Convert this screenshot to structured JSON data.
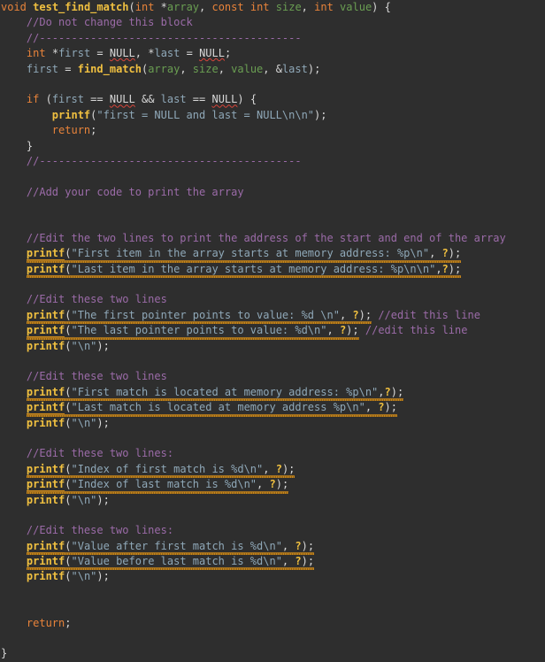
{
  "editor": {
    "language": "c",
    "background_color": "#2e2e2e",
    "colors": {
      "keyword": "#e8833a",
      "function": "#f0c040",
      "parameter": "#6a9e52",
      "variable": "#8fa8b8",
      "string": "#8fa8b8",
      "punctuation": "#d8d8d8",
      "comment": "#9b6ba8",
      "spell_error_underline": "#d9453a",
      "syntax_error_underline": "#c8881e"
    }
  },
  "code": {
    "signature": {
      "return_type": "void",
      "name": "test_find_match",
      "p1_type": "int",
      "p1_star": "*",
      "p1_name": "array",
      "p2_const": "const",
      "p2_type": "int",
      "p2_name": "size",
      "p3_type": "int",
      "p3_name": "value",
      "open_paren": "(",
      "close_paren": ")",
      "comma": ", ",
      "open_brace": " {"
    },
    "comments": {
      "do_not_change": "//Do not change this block",
      "separator": "//-----------------------------------------",
      "add_your_code": "//Add your code to print the array",
      "edit_two_lines_address": "//Edit the two lines to print the address of the start and end of the array",
      "edit_these_two_lines": "//Edit these two lines",
      "edit_these_two_lines_colon": "//Edit these two lines:",
      "edit_this_line": "//edit this line"
    },
    "decl": {
      "type": "int",
      "star1": "*",
      "var1": "first",
      "eq": " = ",
      "null": "NULL",
      "comma": ", ",
      "star2": "*",
      "var2": "last",
      "semi": ";"
    },
    "assign": {
      "lhs": "first",
      "eq": " = ",
      "fn": "find_match",
      "open": "(",
      "a1": "array",
      "a2": "size",
      "a3": "value",
      "amp": "&",
      "a4": "last",
      "comma": ", ",
      "close": ");"
    },
    "ifblock": {
      "kw": "if",
      "open": " (",
      "v1": "first",
      "op1": " == ",
      "null1": "NULL",
      "and": " && ",
      "v2": "last",
      "op2": " == ",
      "null2": "NULL",
      "close": ") {",
      "printf": "printf",
      "msg": "\"first = NULL and last = NULL\\n\\n\"",
      "tail": ");",
      "ret": "return",
      "semi": ";",
      "close_brace": "}"
    },
    "printf_name": "printf",
    "open_paren": "(",
    "close_paren": ")",
    "semicolon": ";",
    "arg_placeholder": "?",
    "comma_space": ", ",
    "comma_nospace": ",",
    "newline_arg": "\"\\n\"",
    "statements": [
      {
        "id": "addr-first",
        "string": "\"First item in the array starts at memory address: %p\\n\"",
        "sep": ", ",
        "arg": "?",
        "error": true
      },
      {
        "id": "addr-last",
        "string": "\"Last item in the array starts at memory address: %p\\n\\n\"",
        "sep": ",",
        "arg": "?",
        "error": true
      },
      {
        "id": "ptr-first",
        "string": "\"The first pointer points to value: %d \\n\"",
        "sep": ", ",
        "arg": "?",
        "error": true,
        "trailing_comment": "//edit this line"
      },
      {
        "id": "ptr-last",
        "string": "\"The last pointer points to value: %d\\n\"",
        "sep": ", ",
        "arg": "?",
        "error": true,
        "trailing_comment": "//edit this line"
      },
      {
        "id": "match-first",
        "string": "\"First match is located at memory address: %p\\n\"",
        "sep": ",",
        "arg": "?",
        "error": true
      },
      {
        "id": "match-last",
        "string": "\"Last match is located at memory address %p\\n\"",
        "sep": ", ",
        "arg": "?",
        "error": true
      },
      {
        "id": "index-first",
        "string": "\"Index of first match is %d\\n\"",
        "sep": ", ",
        "arg": "?",
        "error": true
      },
      {
        "id": "index-last",
        "string": "\"Index of last match is %d\\n\"",
        "sep": ", ",
        "arg": "?",
        "error": true
      },
      {
        "id": "value-after",
        "string": "\"Value after first match is %d\\n\"",
        "sep": ", ",
        "arg": "?",
        "error": true
      },
      {
        "id": "value-before",
        "string": "\"Value before last match is %d\\n\"",
        "sep": ", ",
        "arg": "?",
        "error": true
      }
    ],
    "final": {
      "ret": "return",
      "semi": ";",
      "close_brace": "}"
    }
  }
}
